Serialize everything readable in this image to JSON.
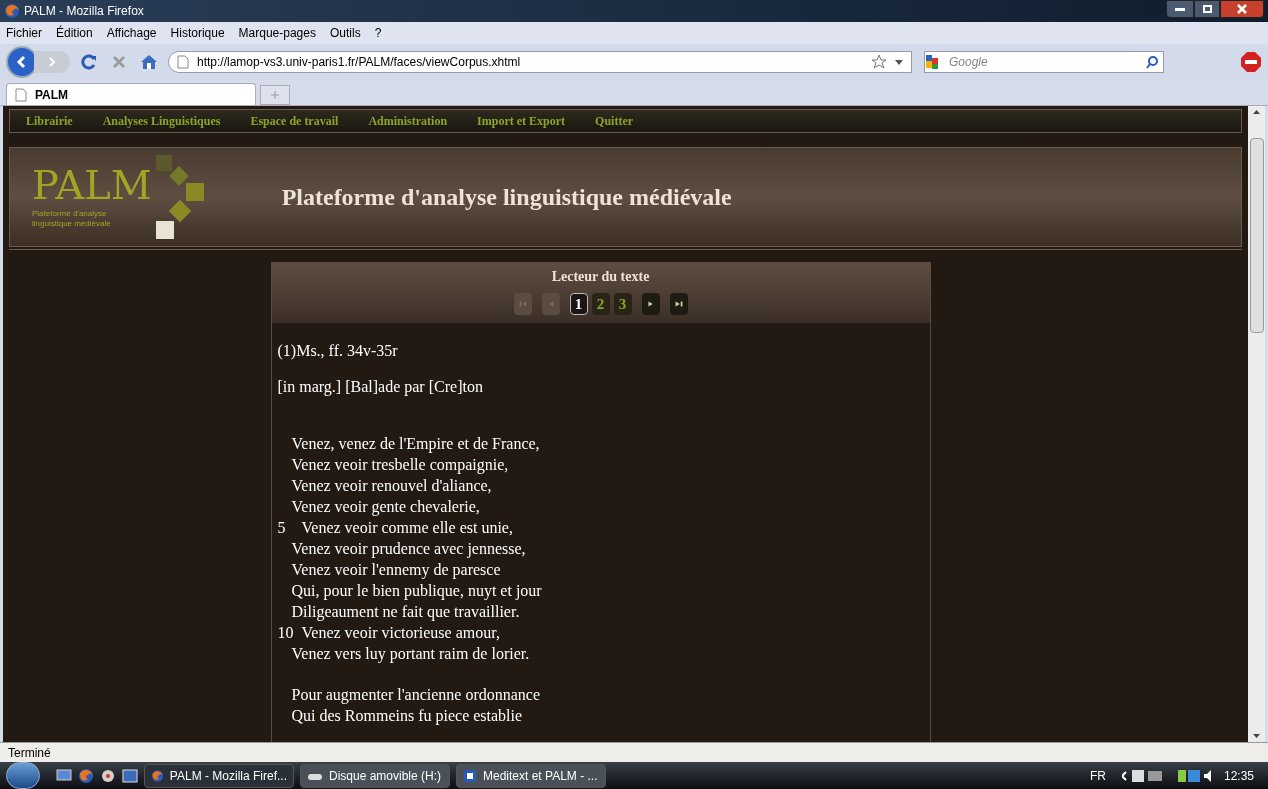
{
  "window": {
    "title": "PALM - Mozilla Firefox"
  },
  "menu": [
    "Fichier",
    "Édition",
    "Affichage",
    "Historique",
    "Marque-pages",
    "Outils",
    "?"
  ],
  "address": {
    "value": "http://lamop-vs3.univ-paris1.fr/PALM/faces/viewCorpus.xhtml"
  },
  "search": {
    "placeholder": "Google"
  },
  "tabs": [
    {
      "label": "PALM",
      "selected": true
    }
  ],
  "site_nav": [
    "Librairie",
    "Analyses Linguistiques",
    "Espace de travail",
    "Administration",
    "Import et Export",
    "Quitter"
  ],
  "logo": {
    "letters": "PALM",
    "tagline": "Plateforme d'analyse linguistique médiévale"
  },
  "site_title": "Plateforme d'analyse linguistique médiévale",
  "reader": {
    "title": "Lecteur du texte",
    "controls": [
      {
        "kind": "first",
        "disabled": true
      },
      {
        "kind": "prev",
        "disabled": true
      }
    ],
    "pages": [
      {
        "label": "1",
        "selected": true
      },
      {
        "label": "2",
        "selected": false
      },
      {
        "label": "3",
        "selected": false
      }
    ],
    "controls_after": [
      {
        "kind": "next",
        "disabled": false
      },
      {
        "kind": "last",
        "disabled": false
      }
    ],
    "paragraphs": [
      "(1)Ms., ff. 34v-35r",
      "[in marg.] [Bal]ade par [Cre]ton"
    ],
    "stanzas": [
      [
        {
          "text": "Venez, venez de l'Empire et de France,"
        },
        {
          "text": "Venez veoir tresbelle compaignie,"
        },
        {
          "text": "Venez veoir renouvel d'aliance,"
        },
        {
          "text": "Venez veoir gente chevalerie,"
        },
        {
          "number": "5",
          "text": "Venez veoir comme elle est unie,"
        },
        {
          "text": "Venez veoir prudence avec jennesse,"
        },
        {
          "text": "Venez veoir l'ennemy de paresce"
        },
        {
          "text": "Qui, pour le bien publique, nuyt et jour"
        },
        {
          "text": "Diligeaument ne fait que travaillier."
        },
        {
          "number": "10",
          "text": "Venez veoir victorieuse amour,"
        },
        {
          "text": "Venez vers luy portant raim de lorier."
        }
      ],
      [
        {
          "text": "Pour augmenter l'ancienne ordonnance"
        },
        {
          "text": "Qui des Rommeins fu piece establie"
        }
      ]
    ]
  },
  "status_bar": "Terminé",
  "taskbar": {
    "items": [
      {
        "label": "PALM - Mozilla Firef...",
        "selected": true,
        "kind": "firefox"
      },
      {
        "label": "Disque amovible (H:)",
        "selected": false,
        "kind": "drive"
      },
      {
        "label": "Meditext et PALM - ...",
        "selected": false,
        "kind": "word"
      }
    ],
    "language": "FR",
    "clock": "12:35"
  }
}
